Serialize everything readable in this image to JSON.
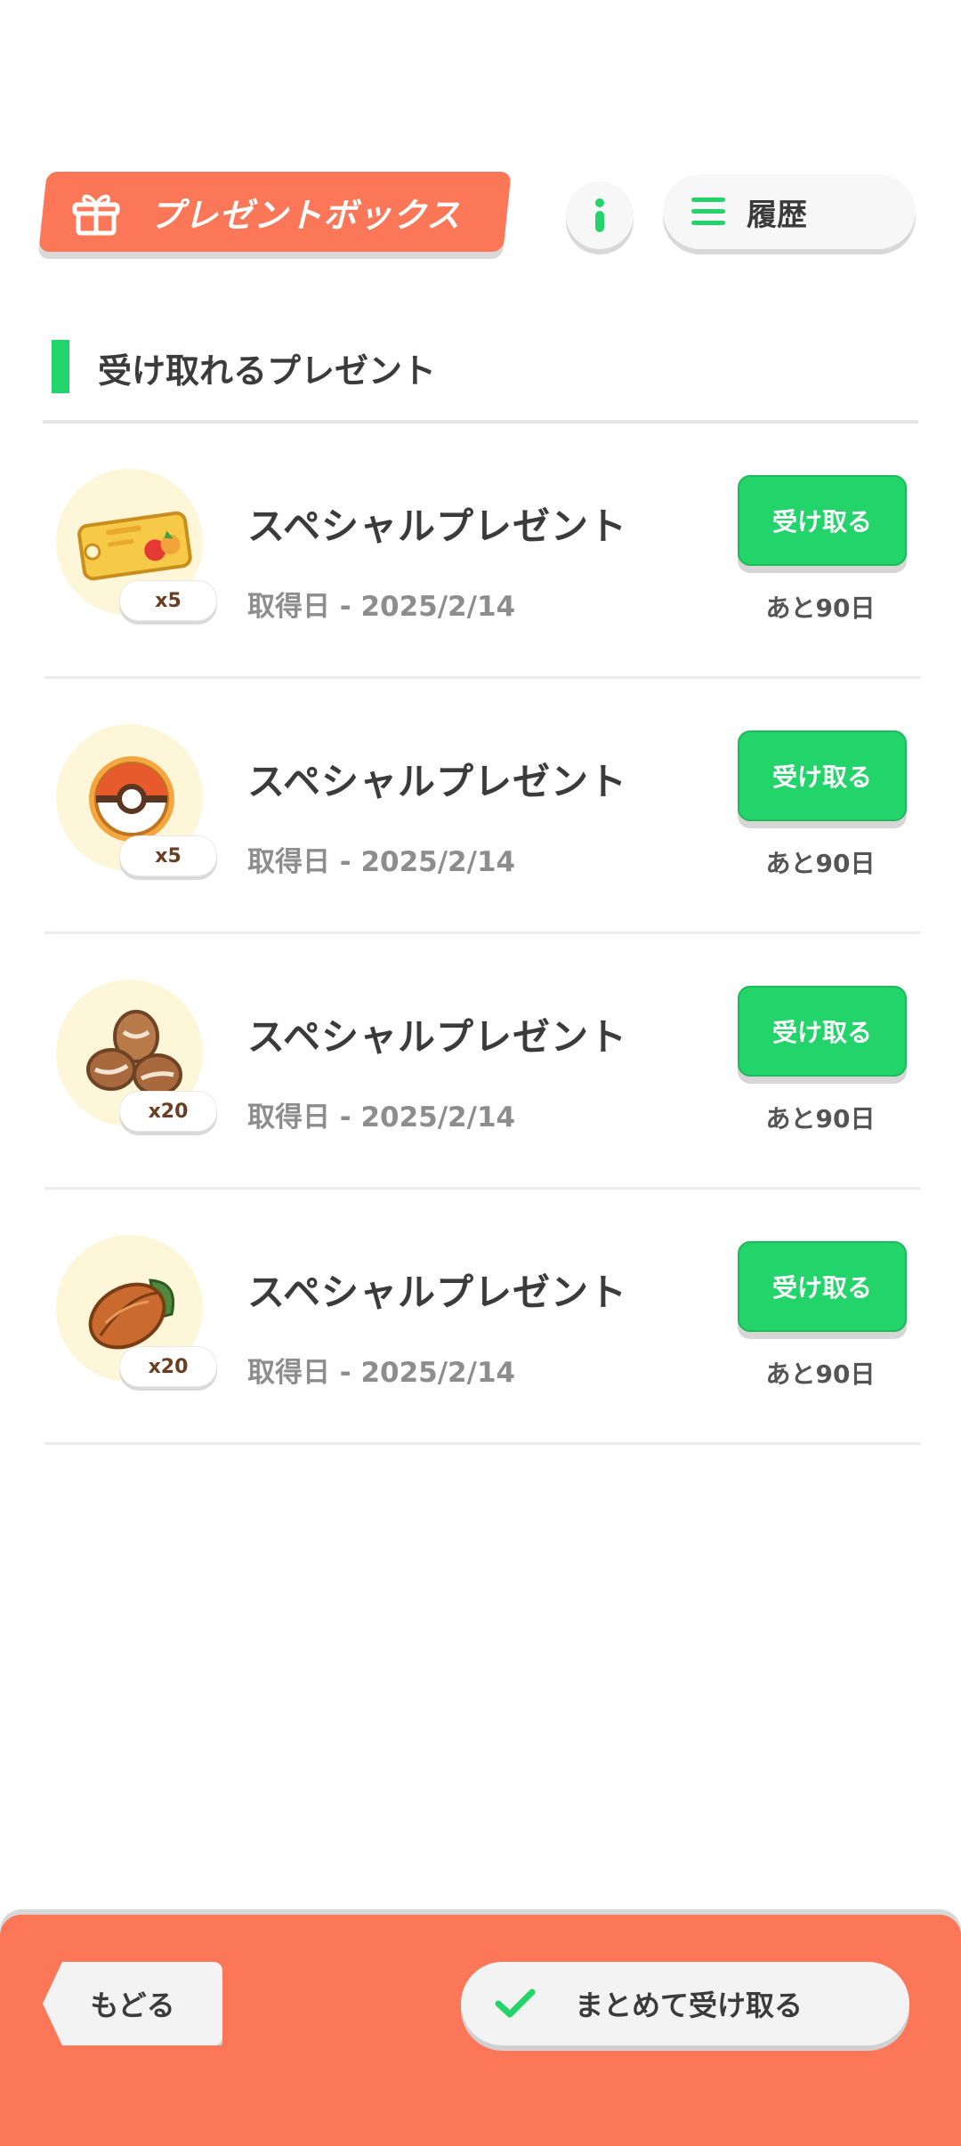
{
  "header": {
    "title": "プレゼントボックス",
    "info_icon": "info-icon",
    "history_label": "履歴"
  },
  "section": {
    "title": "受け取れるプレゼント"
  },
  "items": [
    {
      "icon": "ticket-icon",
      "quantity": "x5",
      "name": "スペシャルプレゼント",
      "date": "取得日 - 2025/2/14",
      "button": "受け取る",
      "remaining": "あと90日"
    },
    {
      "icon": "pokeball-icon",
      "quantity": "x5",
      "name": "スペシャルプレゼント",
      "date": "取得日 - 2025/2/14",
      "button": "受け取る",
      "remaining": "あと90日"
    },
    {
      "icon": "beans-icon",
      "quantity": "x20",
      "name": "スペシャルプレゼント",
      "date": "取得日 - 2025/2/14",
      "button": "受け取る",
      "remaining": "あと90日"
    },
    {
      "icon": "cacao-icon",
      "quantity": "x20",
      "name": "スペシャルプレゼント",
      "date": "取得日 - 2025/2/14",
      "button": "受け取る",
      "remaining": "あと90日"
    }
  ],
  "footer": {
    "back_label": "もどる",
    "bulk_label": "まとめて受け取る"
  },
  "colors": {
    "accent_orange": "#fb7757",
    "accent_green": "#22d46a"
  }
}
